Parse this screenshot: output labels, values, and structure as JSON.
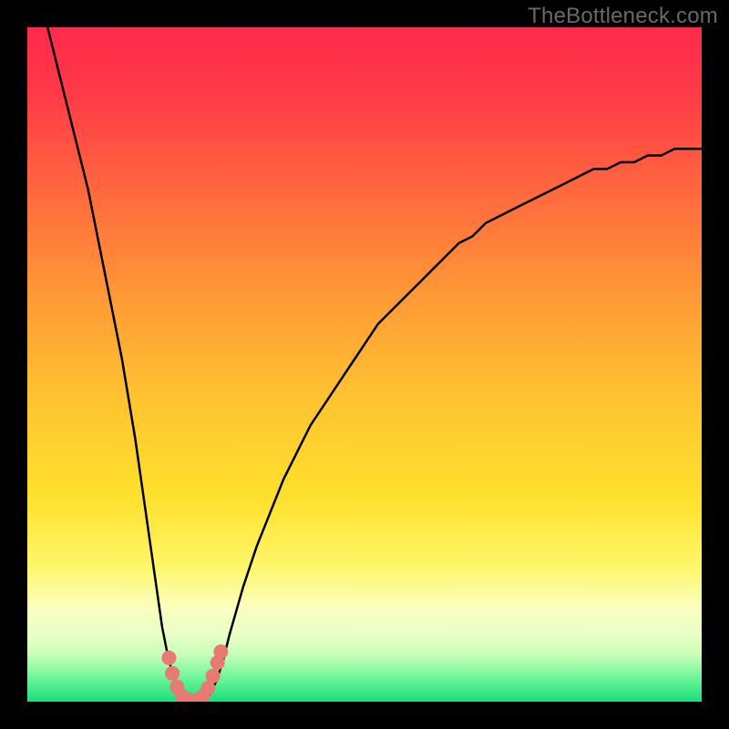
{
  "watermark": "TheBottleneck.com",
  "colors": {
    "top": "#ff2a4b",
    "mid": "#ffcf2a",
    "pale": "#fbffbe",
    "bottom": "#16e07a",
    "curve": "#000000",
    "marker": "#e77a71",
    "frame_bg": "#000000"
  },
  "chart_data": {
    "type": "line",
    "title": "",
    "xlabel": "",
    "ylabel": "",
    "xlim": [
      0,
      100
    ],
    "ylim": [
      0,
      100
    ],
    "x": [
      3,
      4,
      5,
      6,
      7,
      8,
      9,
      10,
      11,
      12,
      13,
      14,
      15,
      16,
      17,
      18,
      19,
      20,
      21,
      22,
      23,
      24,
      25,
      26,
      27,
      28,
      29,
      30,
      32,
      34,
      36,
      38,
      40,
      42,
      44,
      46,
      48,
      50,
      52,
      54,
      56,
      58,
      60,
      62,
      64,
      66,
      68,
      70,
      72,
      74,
      76,
      78,
      80,
      82,
      84,
      86,
      88,
      90,
      92,
      94,
      96,
      98,
      100
    ],
    "y": [
      100,
      96,
      92,
      88,
      84,
      80,
      76,
      71,
      66,
      61,
      56,
      51,
      45,
      39,
      32,
      25,
      18,
      11,
      6,
      3,
      1,
      0,
      0,
      0,
      1,
      3,
      6,
      10,
      17,
      23,
      28,
      33,
      37,
      41,
      44,
      47,
      50,
      53,
      56,
      58,
      60,
      62,
      64,
      66,
      68,
      69,
      71,
      72,
      73,
      74,
      75,
      76,
      77,
      78,
      79,
      79,
      80,
      80,
      81,
      81,
      82,
      82,
      82
    ],
    "markers": [
      {
        "x": 21.0,
        "y": 6.5
      },
      {
        "x": 21.5,
        "y": 4.2
      },
      {
        "x": 22.2,
        "y": 2.2
      },
      {
        "x": 23.0,
        "y": 0.8
      },
      {
        "x": 24.0,
        "y": 0.2
      },
      {
        "x": 25.0,
        "y": 0.2
      },
      {
        "x": 26.0,
        "y": 0.8
      },
      {
        "x": 26.8,
        "y": 2.0
      },
      {
        "x": 27.5,
        "y": 3.8
      },
      {
        "x": 28.2,
        "y": 5.8
      },
      {
        "x": 28.7,
        "y": 7.4
      }
    ],
    "annotations": []
  }
}
